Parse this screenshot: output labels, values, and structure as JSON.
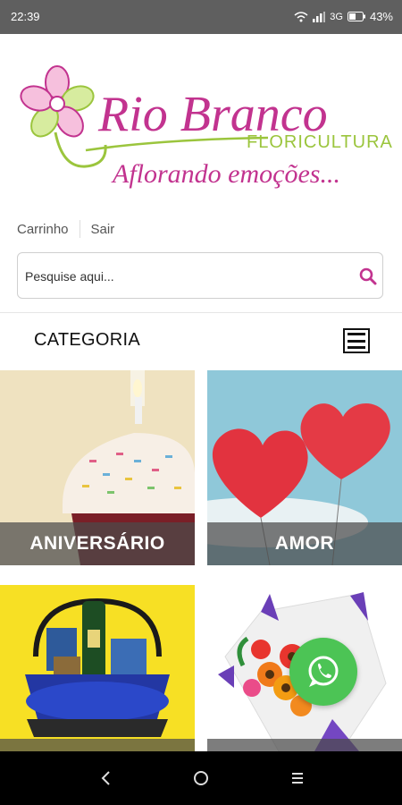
{
  "status_bar": {
    "time": "22:39",
    "network": "3G",
    "battery": "43%"
  },
  "logo": {
    "name": "Rio Branco",
    "subtitle": "FLORICULTURA",
    "tagline": "Aflorando emoções..."
  },
  "toplinks": {
    "cart": "Carrinho",
    "logout": "Sair"
  },
  "search": {
    "placeholder": "Pesquise aqui..."
  },
  "category_bar": {
    "label": "CATEGORIA"
  },
  "tiles": [
    {
      "label": "ANIVERSÁRIO"
    },
    {
      "label": "AMOR"
    },
    {
      "label": ""
    },
    {
      "label": ""
    }
  ],
  "colors": {
    "brand_pink": "#c2338f",
    "brand_green": "#9bc53d",
    "whatsapp": "#4cc455",
    "search_icon": "#c2338f"
  },
  "icons": [
    "search-icon",
    "hamburger-menu-icon",
    "whatsapp-icon",
    "back-icon",
    "home-icon",
    "recents-icon",
    "wifi-icon",
    "signal-icon",
    "battery-icon"
  ]
}
